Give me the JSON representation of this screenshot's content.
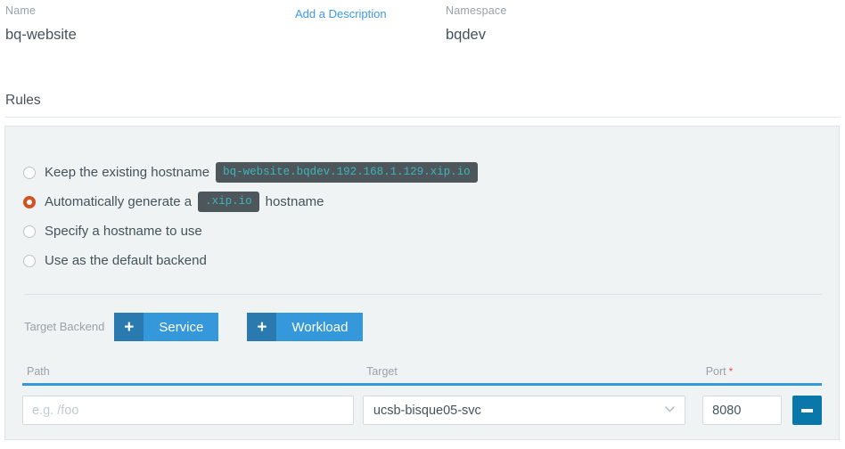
{
  "header": {
    "name_label": "Name",
    "name_value": "bq-website",
    "description_link": "Add a Description",
    "namespace_label": "Namespace",
    "namespace_value": "bqdev"
  },
  "rules_section": {
    "title": "Rules",
    "radio_options": [
      {
        "label_before": "Keep the existing hostname",
        "code": "bq-website.bqdev.192.168.1.129.xip.io",
        "label_after": "",
        "selected": false
      },
      {
        "label_before": "Automatically generate a",
        "code": ".xip.io",
        "label_after": "hostname",
        "selected": true
      },
      {
        "label_before": "Specify a hostname to use",
        "code": "",
        "label_after": "",
        "selected": false
      },
      {
        "label_before": "Use as the default backend",
        "code": "",
        "label_after": "",
        "selected": false
      }
    ],
    "target_backend": {
      "label": "Target Backend",
      "buttons": [
        {
          "icon": "plus-icon",
          "label": "Service"
        },
        {
          "icon": "plus-icon",
          "label": "Workload"
        }
      ]
    },
    "rule_table": {
      "columns": [
        {
          "label": "Path",
          "required": false
        },
        {
          "label": "Target",
          "required": false
        },
        {
          "label": "Port",
          "required": true
        }
      ],
      "rows": [
        {
          "path_value": "",
          "path_placeholder": "e.g. /foo",
          "target_value": "ucsb-bisque05-svc",
          "target_icon": "chevron-down-icon",
          "port_value": "8080",
          "remove_icon": "minus-icon"
        }
      ]
    }
  },
  "colors": {
    "accent_blue": "#3498db",
    "accent_blue_dark": "#2a7ab0",
    "remove_blue": "#0a77ab",
    "radio_selected": "#d05324",
    "required_red": "#e2574c",
    "code_bg": "#4c565b",
    "code_fg": "#3fb5ba",
    "panel_bg": "#f0f3f4",
    "link_blue": "#3d9ae8"
  }
}
